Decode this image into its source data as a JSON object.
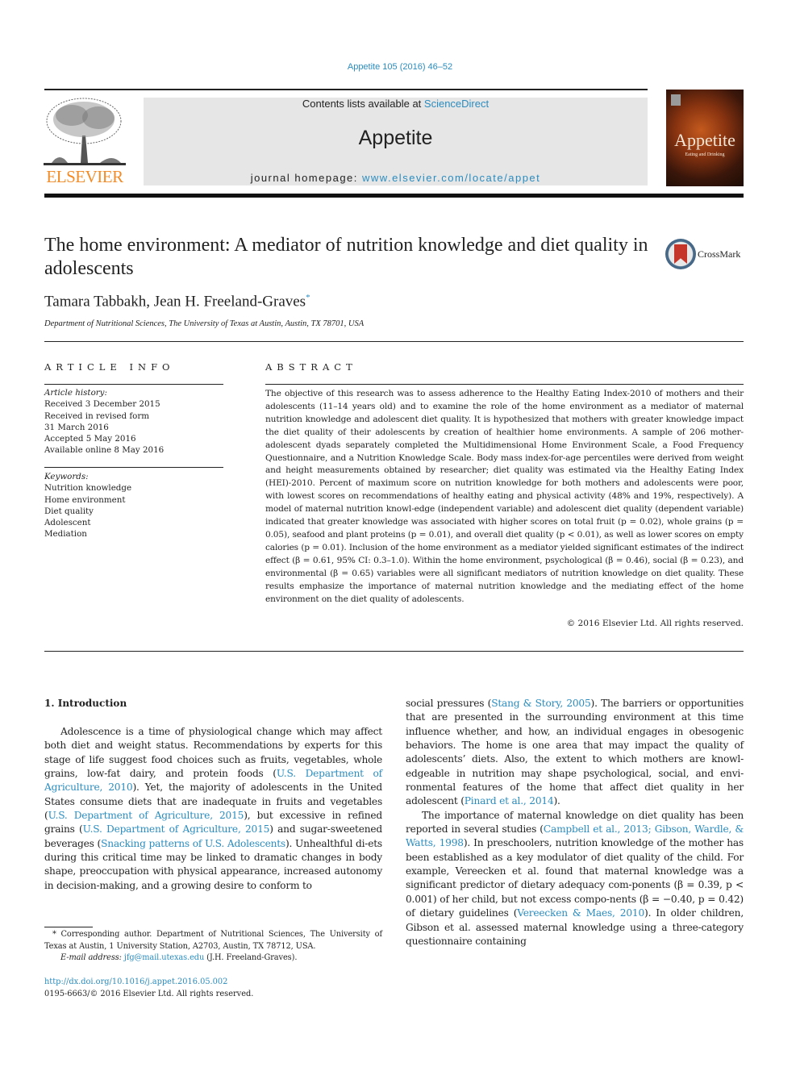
{
  "journal_ref": "Appetite 105 (2016) 46–52",
  "banner": {
    "contents_prefix": "Contents lists available at ",
    "contents_link": "ScienceDirect",
    "journal_title": "Appetite",
    "homepage_prefix": "journal homepage: ",
    "homepage_link": "www.elsevier.com/locate/appet"
  },
  "publisher": {
    "name": "ELSEVIER",
    "logo_icon": "elsevier-tree-icon"
  },
  "cover": {
    "title": "Appetite",
    "subtitle": "Eating and Drinking"
  },
  "crossmark": {
    "label": "CrossMark",
    "icon": "crossmark-icon"
  },
  "title": "The home environment: A mediator of nutrition knowledge and diet quality in adolescents",
  "authors": {
    "names": "Tamara Tabbakh, Jean H. Freeland-Graves",
    "marker": "*"
  },
  "affiliation": "Department of Nutritional Sciences, The University of Texas at Austin, Austin, TX 78701, USA",
  "article_info": {
    "heading": "ARTICLE INFO",
    "history_label": "Article history:",
    "history": [
      "Received 3 December 2015",
      "Received in revised form",
      "31 March 2016",
      "Accepted 5 May 2016",
      "Available online 8 May 2016"
    ],
    "keywords_label": "Keywords:",
    "keywords": [
      "Nutrition knowledge",
      "Home environment",
      "Diet quality",
      "Adolescent",
      "Mediation"
    ]
  },
  "abstract": {
    "heading": "ABSTRACT",
    "text": "The objective of this research was to assess adherence to the Healthy Eating Index-2010 of mothers and their adolescents (11–14 years old) and to examine the role of the home environment as a mediator of maternal nutrition knowledge and adolescent diet quality. It is hypothesized that mothers with greater knowledge impact the diet quality of their adolescents by creation of healthier home environments. A sample of 206 mother-adolescent dyads separately completed the Multidimensional Home Environment Scale, a Food Frequency Questionnaire, and a Nutrition Knowledge Scale. Body mass index-for-age percentiles were derived from weight and height measurements obtained by researcher; diet quality was estimated via the Healthy Eating Index (HEI)-2010. Percent of maximum score on nutrition knowledge for both mothers and adolescents were poor, with lowest scores on recommendations of healthy eating and physical activity (48% and 19%, respectively). A model of maternal nutrition knowl-edge (independent variable) and adolescent diet quality (dependent variable) indicated that greater knowledge was associated with higher scores on total fruit (p = 0.02), whole grains (p = 0.05), seafood and plant proteins (p = 0.01), and overall diet quality (p < 0.01), as well as lower scores on empty calories (p = 0.01). Inclusion of the home environment as a mediator yielded significant estimates of the indirect effect (β = 0.61, 95% CI: 0.3–1.0). Within the home environment, psychological (β = 0.46), social (β = 0.23), and environmental (β = 0.65) variables were all significant mediators of nutrition knowledge on diet quality. These results emphasize the importance of maternal nutrition knowledge and the mediating effect of the home environment on the diet quality of adolescents.",
    "copyright": "© 2016 Elsevier Ltd. All rights reserved."
  },
  "introduction": {
    "heading": "1.  Introduction",
    "left_para": [
      {
        "t": "Adolescence is a time of physiological change which may affect both diet and weight status. Recommendations by experts for this stage of life suggest food choices such as fruits, vegetables, whole grains, low-fat dairy, and protein foods ("
      },
      {
        "l": "U.S. Department of Agriculture, 2010"
      },
      {
        "t": "). Yet, the majority of adolescents in the United States consume diets that are inadequate in fruits and vegetables ("
      },
      {
        "l": "U.S. Department of Agriculture, 2015"
      },
      {
        "t": "), but excessive in refined grains ("
      },
      {
        "l": "U.S. Department of Agriculture, 2015"
      },
      {
        "t": ") and sugar-sweetened beverages ("
      },
      {
        "l": "Snacking patterns of U.S. Adolescents"
      },
      {
        "t": "). Unhealthful di-ets during this critical time may be linked to dramatic changes in body shape, preoccupation with physical appearance, increased autonomy in decision-making, and a growing desire to conform to"
      }
    ],
    "right_para_1": [
      {
        "t": "social pressures ("
      },
      {
        "l": "Stang & Story, 2005"
      },
      {
        "t": "). The barriers or opportunities that are presented in the surrounding environment at this time influence whether, and how, an individual engages in obesogenic behaviors. The home is one area that may impact the quality of adolescents’ diets. Also, the extent to which mothers are knowl-edgeable in nutrition may shape psychological, social, and envi-ronmental features of the home that affect diet quality in her adolescent ("
      },
      {
        "l": "Pinard et al., 2014"
      },
      {
        "t": ")."
      }
    ],
    "right_para_2": [
      {
        "t": "The importance of maternal knowledge on diet quality has been reported in several studies ("
      },
      {
        "l": "Campbell et al., 2013; Gibson, Wardle, & Watts, 1998"
      },
      {
        "t": "). In preschoolers, nutrition knowledge of the mother has been established as a key modulator of diet quality of the child. For example, Vereecken et al. found that maternal knowledge was a significant predictor of dietary adequacy com-ponents (β = 0.39, p < 0.001) of her child, but not excess compo-nents (β = −0.40, p = 0.42) of dietary guidelines ("
      },
      {
        "l": "Vereecken & Maes, 2010"
      },
      {
        "t": "). In older children, Gibson et al. assessed maternal knowledge using a three-category questionnaire containing"
      }
    ]
  },
  "footnote": {
    "corresponding": "* Corresponding author. Department of Nutritional Sciences, The University of Texas at Austin, 1 University Station, A2703, Austin, TX 78712, USA.",
    "email_label": "E-mail address: ",
    "email": "jfg@mail.utexas.edu",
    "email_suffix": " (J.H. Freeland-Graves).",
    "doi": "http://dx.doi.org/10.1016/j.appet.2016.05.002",
    "issn": "0195-6663/© 2016 Elsevier Ltd. All rights reserved."
  }
}
